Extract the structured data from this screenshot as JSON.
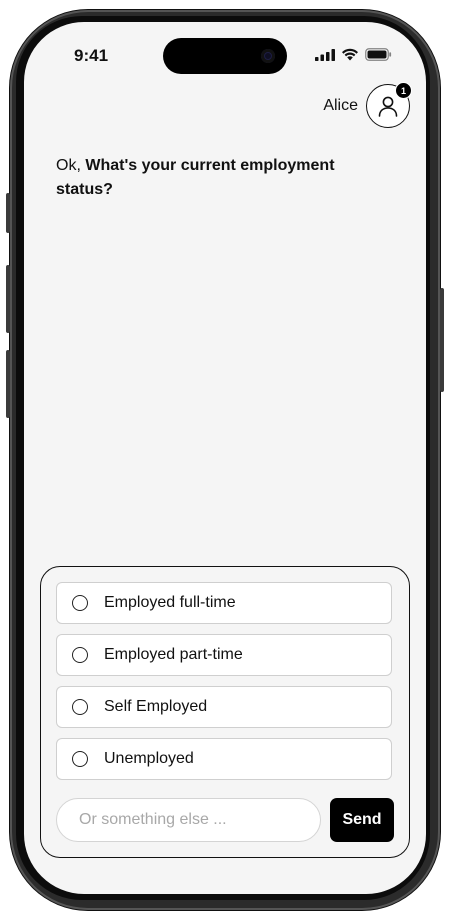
{
  "status_bar": {
    "time": "9:41",
    "icons": [
      "cellular-signal-icon",
      "wifi-icon",
      "battery-icon"
    ]
  },
  "header": {
    "user_name": "Alice",
    "avatar_icon": "user-icon",
    "notification_count": "1"
  },
  "chat": {
    "question_prefix": "Ok, ",
    "question_bold": "What's your current employment status?"
  },
  "options": [
    {
      "label": "Employed full-time",
      "selected": false
    },
    {
      "label": "Employed part-time",
      "selected": false
    },
    {
      "label": "Self Employed",
      "selected": false
    },
    {
      "label": "Unemployed",
      "selected": false
    }
  ],
  "composer": {
    "placeholder": "Or something else ...",
    "value": "",
    "send_label": "Send"
  },
  "colors": {
    "screen_background": "#f5f5f5",
    "accent": "#000000",
    "option_background": "#ffffff"
  }
}
